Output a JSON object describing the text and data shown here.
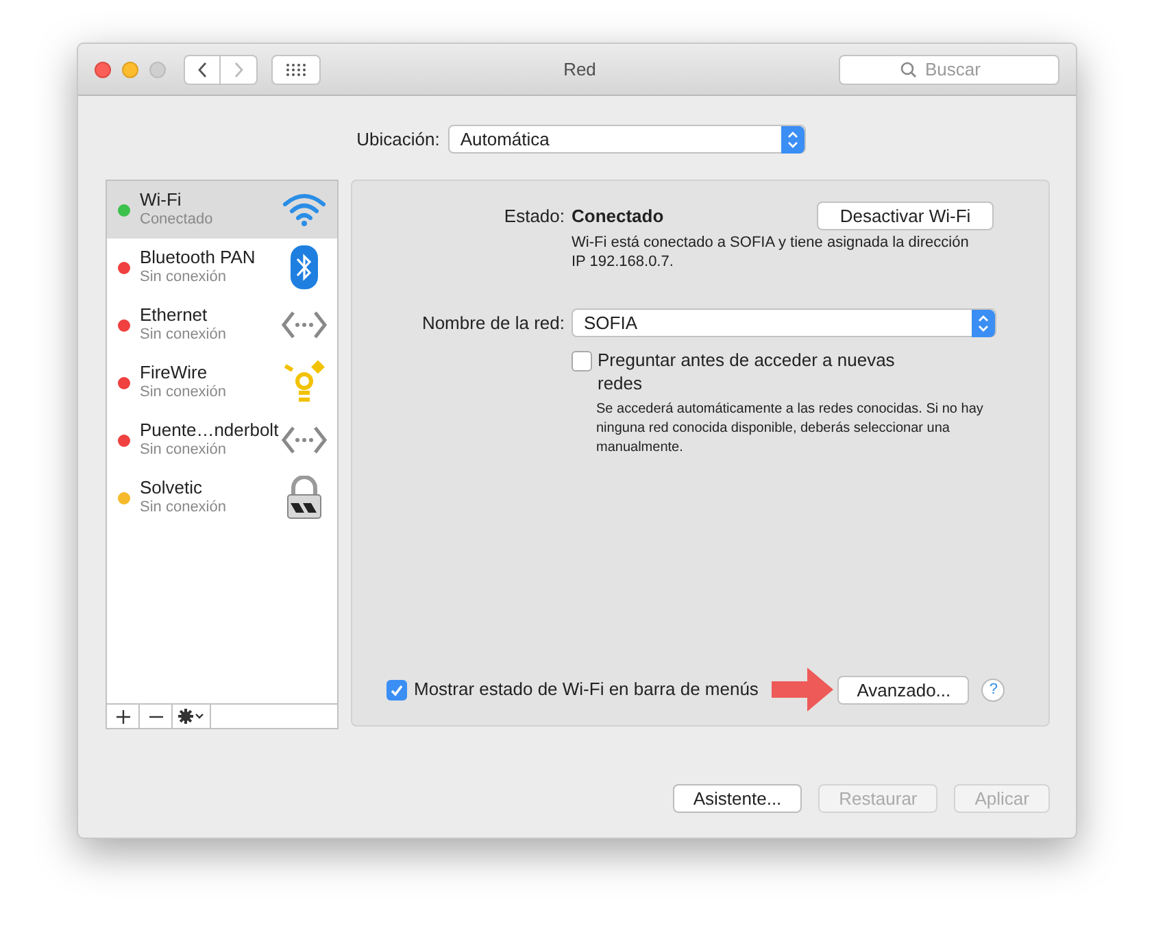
{
  "window": {
    "title": "Red"
  },
  "search": {
    "placeholder": "Buscar"
  },
  "location": {
    "label": "Ubicación:",
    "value": "Automática"
  },
  "services": [
    {
      "name": "Wi-Fi",
      "status": "Conectado",
      "color": "#3cc14a",
      "kind": "wifi",
      "selected": true
    },
    {
      "name": "Bluetooth PAN",
      "status": "Sin conexión",
      "color": "#f04040",
      "kind": "bluetooth",
      "selected": false
    },
    {
      "name": "Ethernet",
      "status": "Sin conexión",
      "color": "#f04040",
      "kind": "ethernet",
      "selected": false
    },
    {
      "name": "FireWire",
      "status": "Sin conexión",
      "color": "#f04040",
      "kind": "firewire",
      "selected": false
    },
    {
      "name": "Puente…nderbolt",
      "status": "Sin conexión",
      "color": "#f04040",
      "kind": "ethernet",
      "selected": false
    },
    {
      "name": "Solvetic",
      "status": "Sin conexión",
      "color": "#f5b92b",
      "kind": "lock",
      "selected": false
    }
  ],
  "detail": {
    "status_label": "Estado:",
    "status_value": "Conectado",
    "toggle_button": "Desactivar Wi-Fi",
    "status_note": "Wi-Fi está conectado a SOFIA y tiene asignada la dirección IP 192.168.0.7.",
    "network_label": "Nombre de la red:",
    "network_value": "SOFIA",
    "ask_checkbox": {
      "label": "Preguntar antes de acceder a nuevas redes",
      "checked": false
    },
    "ask_note": "Se accederá automáticamente a las redes conocidas. Si no hay ninguna red conocida disponible, deberás seleccionar una manualmente.",
    "menu_checkbox": {
      "label": "Mostrar estado de Wi-Fi en barra de menús",
      "checked": true
    },
    "advanced_button": "Avanzado...",
    "help_button": "?"
  },
  "buttons": [
    {
      "label": "Asistente...",
      "disabled": false
    },
    {
      "label": "Restaurar",
      "disabled": true
    },
    {
      "label": "Aplicar",
      "disabled": true
    }
  ]
}
